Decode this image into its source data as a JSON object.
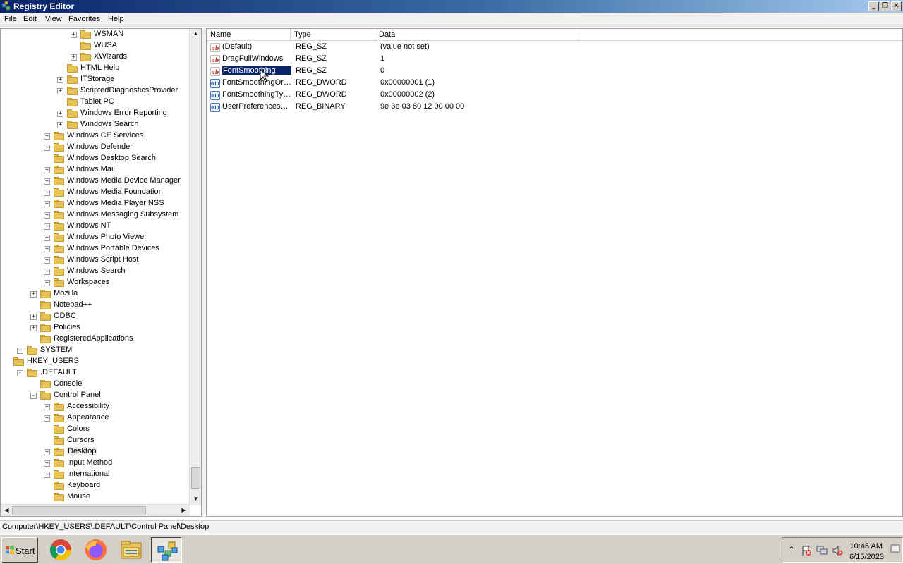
{
  "window": {
    "title": "Registry Editor",
    "minimize": "_",
    "maximize": "❐",
    "close": "✕"
  },
  "menu": [
    "File",
    "Edit",
    "View",
    "Favorites",
    "Help"
  ],
  "tree": [
    {
      "label": "WSMAN",
      "level": 5,
      "expander": "+"
    },
    {
      "label": "WUSA",
      "level": 5,
      "expander": ""
    },
    {
      "label": "XWizards",
      "level": 5,
      "expander": "+"
    },
    {
      "label": "HTML Help",
      "level": 4,
      "expander": ""
    },
    {
      "label": "ITStorage",
      "level": 4,
      "expander": "+"
    },
    {
      "label": "ScriptedDiagnosticsProvider",
      "level": 4,
      "expander": "+"
    },
    {
      "label": "Tablet PC",
      "level": 4,
      "expander": ""
    },
    {
      "label": "Windows Error Reporting",
      "level": 4,
      "expander": "+"
    },
    {
      "label": "Windows Search",
      "level": 4,
      "expander": "+"
    },
    {
      "label": "Windows CE Services",
      "level": 3,
      "expander": "+"
    },
    {
      "label": "Windows Defender",
      "level": 3,
      "expander": "+"
    },
    {
      "label": "Windows Desktop Search",
      "level": 3,
      "expander": ""
    },
    {
      "label": "Windows Mail",
      "level": 3,
      "expander": "+"
    },
    {
      "label": "Windows Media Device Manager",
      "level": 3,
      "expander": "+"
    },
    {
      "label": "Windows Media Foundation",
      "level": 3,
      "expander": "+"
    },
    {
      "label": "Windows Media Player NSS",
      "level": 3,
      "expander": "+"
    },
    {
      "label": "Windows Messaging Subsystem",
      "level": 3,
      "expander": "+"
    },
    {
      "label": "Windows NT",
      "level": 3,
      "expander": "+"
    },
    {
      "label": "Windows Photo Viewer",
      "level": 3,
      "expander": "+"
    },
    {
      "label": "Windows Portable Devices",
      "level": 3,
      "expander": "+"
    },
    {
      "label": "Windows Script Host",
      "level": 3,
      "expander": "+"
    },
    {
      "label": "Windows Search",
      "level": 3,
      "expander": "+"
    },
    {
      "label": "Workspaces",
      "level": 3,
      "expander": "+"
    },
    {
      "label": "Mozilla",
      "level": 2,
      "expander": "+"
    },
    {
      "label": "Notepad++",
      "level": 2,
      "expander": ""
    },
    {
      "label": "ODBC",
      "level": 2,
      "expander": "+"
    },
    {
      "label": "Policies",
      "level": 2,
      "expander": "+"
    },
    {
      "label": "RegisteredApplications",
      "level": 2,
      "expander": ""
    },
    {
      "label": "SYSTEM",
      "level": 1,
      "expander": "+"
    },
    {
      "label": "HKEY_USERS",
      "level": 0,
      "expander": ""
    },
    {
      "label": ".DEFAULT",
      "level": 1,
      "expander": "-"
    },
    {
      "label": "Console",
      "level": 2,
      "expander": ""
    },
    {
      "label": "Control Panel",
      "level": 2,
      "expander": "-"
    },
    {
      "label": "Accessibility",
      "level": 3,
      "expander": "+"
    },
    {
      "label": "Appearance",
      "level": 3,
      "expander": "+"
    },
    {
      "label": "Colors",
      "level": 3,
      "expander": ""
    },
    {
      "label": "Cursors",
      "level": 3,
      "expander": ""
    },
    {
      "label": "Desktop",
      "level": 3,
      "expander": "+",
      "selected": true
    },
    {
      "label": "Input Method",
      "level": 3,
      "expander": "+"
    },
    {
      "label": "International",
      "level": 3,
      "expander": "+"
    },
    {
      "label": "Keyboard",
      "level": 3,
      "expander": ""
    },
    {
      "label": "Mouse",
      "level": 3,
      "expander": ""
    }
  ],
  "columns": {
    "name": "Name",
    "type": "Type",
    "data": "Data"
  },
  "values": [
    {
      "icon": "ab",
      "name": "(Default)",
      "type": "REG_SZ",
      "data": "(value not set)"
    },
    {
      "icon": "ab",
      "name": "DragFullWindows",
      "type": "REG_SZ",
      "data": "1"
    },
    {
      "icon": "ab",
      "name": "FontSmoothing",
      "type": "REG_SZ",
      "data": "0",
      "selected": true
    },
    {
      "icon": "bin",
      "name": "FontSmoothingOr…",
      "type": "REG_DWORD",
      "data": "0x00000001 (1)"
    },
    {
      "icon": "bin",
      "name": "FontSmoothingType",
      "type": "REG_DWORD",
      "data": "0x00000002 (2)"
    },
    {
      "icon": "bin",
      "name": "UserPreferences…",
      "type": "REG_BINARY",
      "data": "9e 3e 03 80 12 00 00 00"
    }
  ],
  "status": {
    "path": "Computer\\HKEY_USERS\\.DEFAULT\\Control Panel\\Desktop"
  },
  "taskbar": {
    "start_label": "Start",
    "apps": [
      "chrome-icon",
      "firefox-icon",
      "file-explorer-icon",
      "regedit-icon"
    ],
    "tray_arrow": "⌃",
    "time": "10:45 AM",
    "date": "6/15/2023"
  },
  "colors": {
    "selection": "#0a246a",
    "folder": "#e8c35a",
    "titlebar": "#0a246a"
  }
}
